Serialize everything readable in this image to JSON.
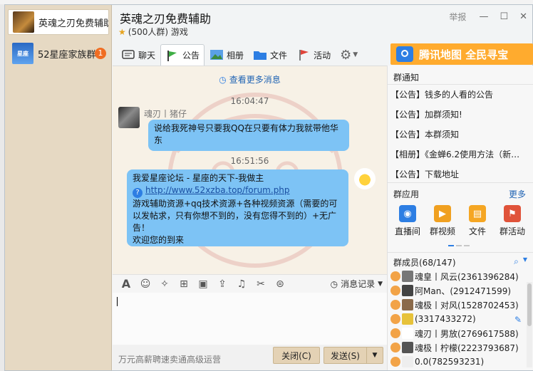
{
  "sessions": [
    {
      "name": "英魂之刃免费辅助",
      "avatar_text": ""
    },
    {
      "name": "52星座家族群",
      "avatar_text": "星座",
      "badge": "1"
    }
  ],
  "header": {
    "title": "英魂之刃免费辅助",
    "subtitle": "(500人群) 游戏",
    "report": "举报"
  },
  "tabs": [
    {
      "label": "聊天"
    },
    {
      "label": "公告"
    },
    {
      "label": "相册"
    },
    {
      "label": "文件"
    },
    {
      "label": "活动"
    }
  ],
  "ad": {
    "text": "腾讯地图 全民寻宝"
  },
  "chat": {
    "more_messages": "查看更多消息",
    "time1": "16:04:47",
    "sender1": "魂刃丨猪仔",
    "msg1": "说给我死神号只要我QQ在只要有体力我就带他华东",
    "time2": "16:51:56",
    "msg2_line1": "我爱星座论坛 - 星座的天下-我做主",
    "msg2_link": "http://www.52xzba.top/forum.php",
    "msg2_rest": "游戏辅助资源+qq技术资源+各种视频资源（需要的可以发帖求，只有你想不到的，没有您得不到的）+无广告！",
    "msg2_last": "欢迎您的到来"
  },
  "input": {
    "history": "消息记录",
    "footer_ad": "万元高薪聘速卖通高级运营",
    "close": "关闭(C)",
    "send": "发送(S)"
  },
  "right": {
    "notice_title": "群通知",
    "notices": [
      "【公告】钱多的人看的公告",
      "【公告】加群须知!",
      "【公告】本群须知",
      "【相册】《金蝉6.2使用方法（新…",
      "【公告】下载地址"
    ],
    "apps_title": "群应用",
    "more": "更多",
    "apps": [
      {
        "label": "直播间",
        "color": "#2d7ee3"
      },
      {
        "label": "群视频",
        "color": "#f0a020"
      },
      {
        "label": "文件",
        "color": "#f5a623"
      },
      {
        "label": "群活动",
        "color": "#e0533a"
      }
    ],
    "members_title": "群成员(68/147)",
    "members": [
      "魂皇丨风云(2361396284)",
      "阿Man、(2912471599)",
      "魂极丨对风(1528702453)",
      "(3317433272)",
      "魂刃丨男放(2769617588)",
      "魂极丨柠檬(2223793687)",
      "0.0(782593231)"
    ]
  }
}
